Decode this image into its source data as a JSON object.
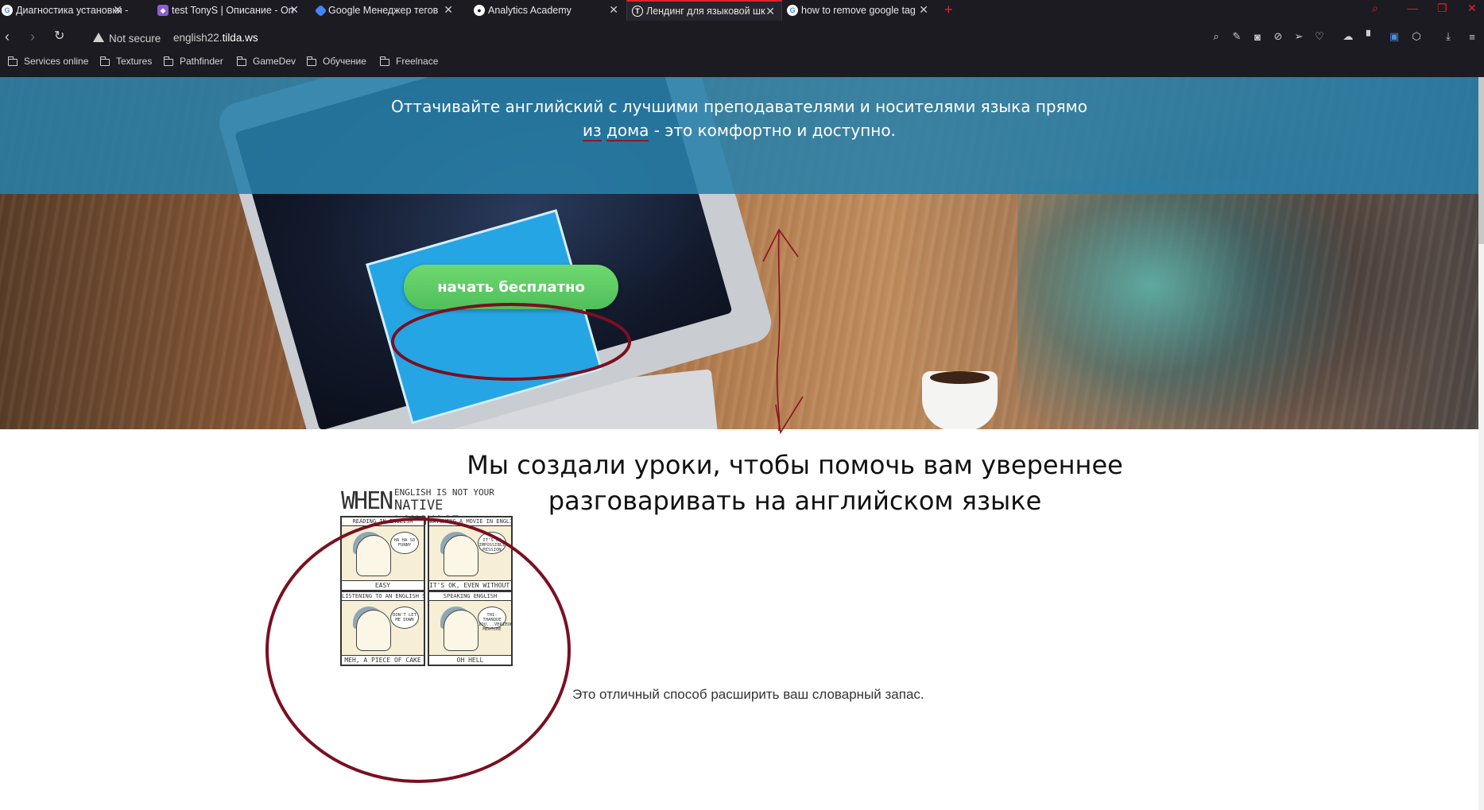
{
  "tabs": [
    {
      "label": "Диагностика установки - G",
      "icon": "google-icon"
    },
    {
      "label": "test TonyS | Описание - On",
      "icon": "tag-manager-icon"
    },
    {
      "label": "Google Менеджер тегов",
      "icon": "tag-manager-icon"
    },
    {
      "label": "Analytics Academy",
      "icon": "globe-icon"
    },
    {
      "label": "Лендинг для языковой шк",
      "icon": "tilda-icon",
      "active": true
    },
    {
      "label": "how to remove google tag",
      "icon": "google-icon"
    }
  ],
  "address": {
    "security": "Not secure",
    "url_prefix": "english22.",
    "url_domain": "tilda.ws"
  },
  "bookmarks": [
    {
      "label": "Services online"
    },
    {
      "label": "Textures"
    },
    {
      "label": "Pathfinder"
    },
    {
      "label": "GameDev"
    },
    {
      "label": "Обучение"
    },
    {
      "label": "Freelnace"
    }
  ],
  "hero": {
    "line_start": "Оттачивайте английский с лучшими преподавателями и носителями языка прямо ",
    "underline_1": "из",
    "underline_2": "дома",
    "line_end": " - это комфортно и доступно.",
    "cta_label": "начать бесплатно",
    "skype_logo": "skype"
  },
  "section": {
    "title": "Мы создали уроки, чтобы помочь вам увереннее разговаривать на английском языке",
    "description": "Это отличный способ расширить ваш словарный запас."
  },
  "comic": {
    "when": "WHEN",
    "subtitle_top": "ENGLISH IS NOT YOUR",
    "subtitle_big": "NATIVE LANGUAGE",
    "panels": [
      {
        "top": "READING IN ENGLISH",
        "bottom": "EASY",
        "bubble": "HA HA SO FUNNY"
      },
      {
        "top": "WATCHING A MOVIE IN ENGLISH",
        "bottom": "IT'S OK, EVEN WITHOUT SUBTITLES",
        "bubble": "IT'S AN IMPOSSIBLE MISSION"
      },
      {
        "top": "LISTENING TO AN ENGLISH SONG",
        "bottom": "MEH, A PIECE OF CAKE",
        "bubble": "DON'T LET ME DOWN"
      },
      {
        "top": "SPEAKING ENGLISH",
        "bottom": "OH HELL",
        "bubble": "THI-THANQUE IOU...VERIEUH MEUTCHE"
      }
    ]
  },
  "colors": {
    "chrome_bg": "#1c1b22",
    "accent_red": "#e0232d",
    "hero_overlay": "#2880aa",
    "cta_green": "#5ccb64",
    "annotation_red": "#7a1020"
  }
}
